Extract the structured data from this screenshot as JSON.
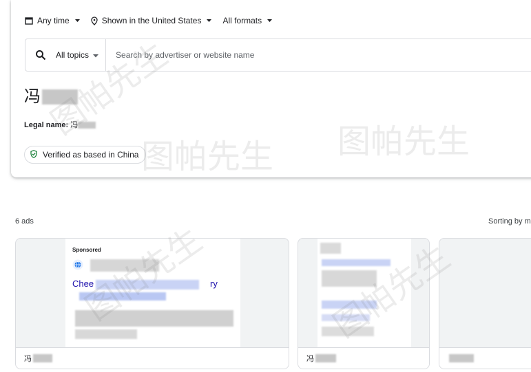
{
  "filters": {
    "time": "Any time",
    "region": "Shown in the United States",
    "format": "All formats"
  },
  "search": {
    "topics_label": "All topics",
    "placeholder": "Search by advertiser or website name"
  },
  "advertiser": {
    "name_prefix": "冯",
    "legal_label": "Legal name:",
    "legal_value": "冯",
    "verified_label": "Verified as based in China"
  },
  "results": {
    "count_label": "6 ads",
    "sorting_label": "Sorting by m"
  },
  "ads": [
    {
      "sponsored": "Sponsored",
      "headline": "Chee",
      "headline_end": "ry",
      "footer_name": "冯"
    },
    {
      "footer_name": "冯"
    },
    {
      "footer_name": ""
    }
  ],
  "watermark": "图帕先生",
  "colors": {
    "link": "#1a0dab",
    "verified_icon": "#188038",
    "border": "#dadce0"
  }
}
